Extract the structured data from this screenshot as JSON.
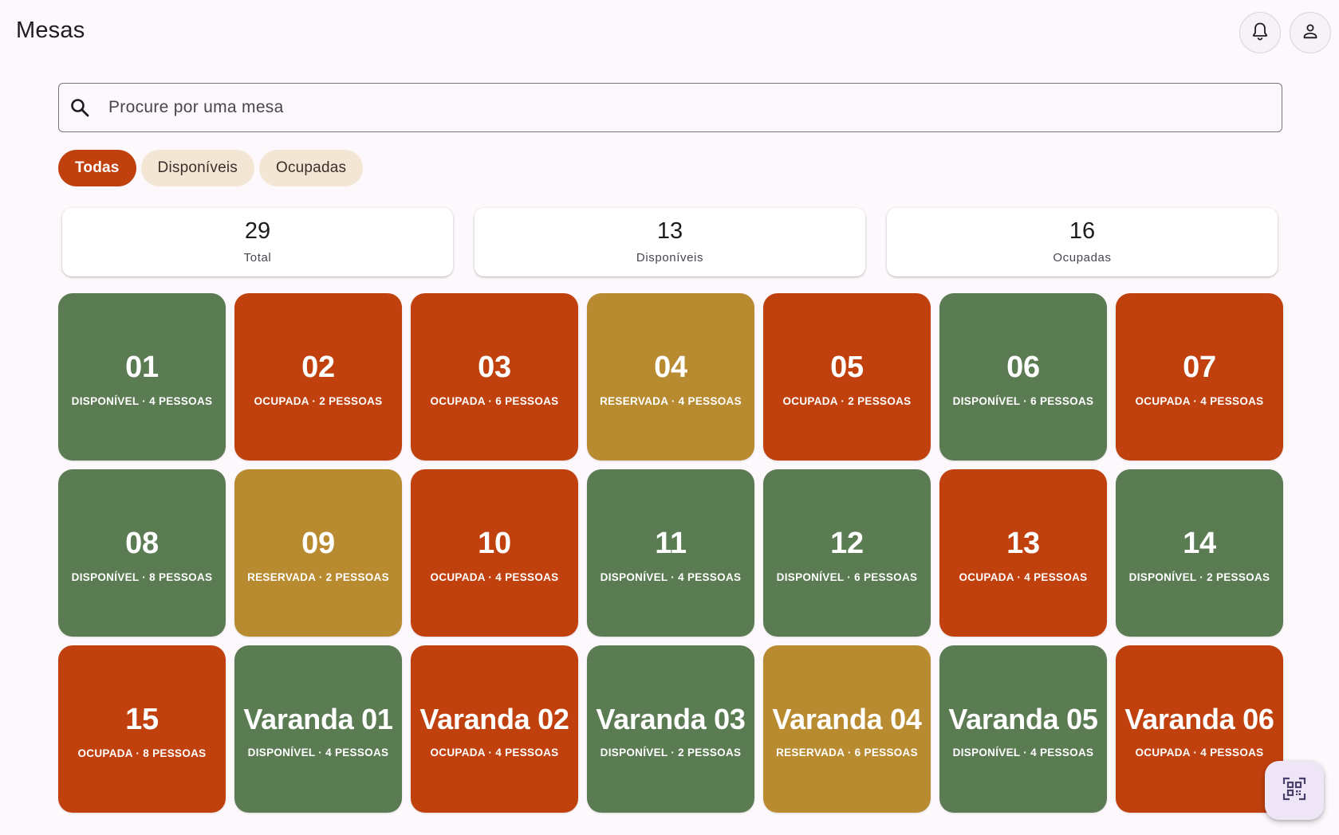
{
  "header": {
    "title": "Mesas",
    "icons": [
      "bell-icon",
      "person-icon"
    ]
  },
  "search": {
    "placeholder": "Procure por uma mesa",
    "value": "",
    "icon": "search-icon"
  },
  "filters": [
    {
      "label": "Todas",
      "active": true
    },
    {
      "label": "Disponíveis",
      "active": false
    },
    {
      "label": "Ocupadas",
      "active": false
    }
  ],
  "stats": [
    {
      "value": "29",
      "label": "Total"
    },
    {
      "value": "13",
      "label": "Disponíveis"
    },
    {
      "value": "16",
      "label": "Ocupadas"
    }
  ],
  "tables": [
    {
      "name": "01",
      "status": "disponivel",
      "subtitle": "DISPONÍVEL · 4 PESSOAS"
    },
    {
      "name": "02",
      "status": "ocupada",
      "subtitle": "OCUPADA · 2 PESSOAS"
    },
    {
      "name": "03",
      "status": "ocupada",
      "subtitle": "OCUPADA · 6 PESSOAS"
    },
    {
      "name": "04",
      "status": "reservada",
      "subtitle": "RESERVADA · 4 PESSOAS"
    },
    {
      "name": "05",
      "status": "ocupada",
      "subtitle": "OCUPADA · 2 PESSOAS"
    },
    {
      "name": "06",
      "status": "disponivel",
      "subtitle": "DISPONÍVEL · 6 PESSOAS"
    },
    {
      "name": "07",
      "status": "ocupada",
      "subtitle": "OCUPADA · 4 PESSOAS"
    },
    {
      "name": "08",
      "status": "disponivel",
      "subtitle": "DISPONÍVEL · 8 PESSOAS"
    },
    {
      "name": "09",
      "status": "reservada",
      "subtitle": "RESERVADA · 2 PESSOAS"
    },
    {
      "name": "10",
      "status": "ocupada",
      "subtitle": "OCUPADA · 4 PESSOAS"
    },
    {
      "name": "11",
      "status": "disponivel",
      "subtitle": "DISPONÍVEL · 4 PESSOAS"
    },
    {
      "name": "12",
      "status": "disponivel",
      "subtitle": "DISPONÍVEL · 6 PESSOAS"
    },
    {
      "name": "13",
      "status": "ocupada",
      "subtitle": "OCUPADA · 4 PESSOAS"
    },
    {
      "name": "14",
      "status": "disponivel",
      "subtitle": "DISPONÍVEL · 2 PESSOAS"
    },
    {
      "name": "15",
      "status": "ocupada",
      "subtitle": "OCUPADA · 8 PESSOAS"
    },
    {
      "name": "Varanda 01",
      "status": "disponivel",
      "subtitle": "DISPONÍVEL · 4 PESSOAS"
    },
    {
      "name": "Varanda 02",
      "status": "ocupada",
      "subtitle": "OCUPADA · 4 PESSOAS"
    },
    {
      "name": "Varanda 03",
      "status": "disponivel",
      "subtitle": "DISPONÍVEL · 2 PESSOAS"
    },
    {
      "name": "Varanda 04",
      "status": "reservada",
      "subtitle": "RESERVADA · 6 PESSOAS"
    },
    {
      "name": "Varanda 05",
      "status": "disponivel",
      "subtitle": "DISPONÍVEL · 4 PESSOAS"
    },
    {
      "name": "Varanda 06",
      "status": "ocupada",
      "subtitle": "OCUPADA · 4 PESSOAS"
    }
  ],
  "colors": {
    "disponivel": "#5b7b53",
    "ocupada": "#c1410e",
    "reservada": "#b98b31",
    "chip_active": "#c0410e",
    "chip_inactive": "#f3e6d5",
    "background": "#fdf8fc"
  },
  "fab": {
    "icon": "qr-scan-icon"
  }
}
